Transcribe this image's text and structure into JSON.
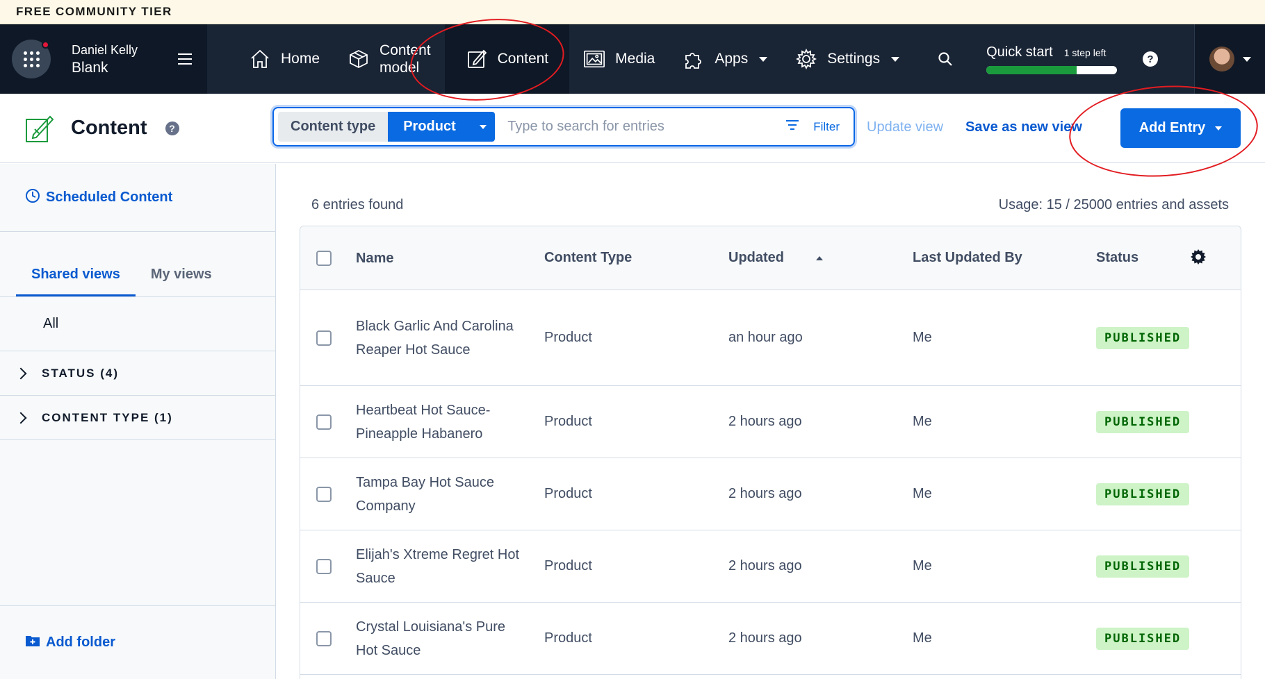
{
  "banner": {
    "text": "FREE COMMUNITY TIER"
  },
  "org": {
    "line1": "Daniel Kelly",
    "line2": "Blank"
  },
  "nav": {
    "home": "Home",
    "content_model_l1": "Content",
    "content_model_l2": "model",
    "content": "Content",
    "media": "Media",
    "apps": "Apps",
    "settings": "Settings"
  },
  "quickstart": {
    "title": "Quick start",
    "steps": "1 step left",
    "progress": 0.69
  },
  "header": {
    "title": "Content",
    "content_type_label": "Content type",
    "content_type_value": "Product",
    "search_placeholder": "Type to search for entries",
    "filter_label": "Filter",
    "update_view": "Update view",
    "save_view": "Save as new view",
    "add_entry": "Add Entry"
  },
  "sidebar": {
    "scheduled": "Scheduled Content",
    "tabs": [
      "Shared views",
      "My views"
    ],
    "all": "All",
    "folders": [
      "STATUS (4)",
      "CONTENT TYPE (1)"
    ],
    "add_folder": "Add folder"
  },
  "main": {
    "entries_found": "6 entries found",
    "usage": "Usage: 15 / 25000 entries and assets",
    "columns": [
      "Name",
      "Content Type",
      "Updated",
      "Last Updated By",
      "Status"
    ],
    "rows": [
      {
        "name": "Black Garlic And Carolina Reaper Hot Sauce",
        "type": "Product",
        "updated": "an hour ago",
        "by": "Me",
        "status": "PUBLISHED"
      },
      {
        "name": "Heartbeat Hot Sauce-Pineapple Habanero",
        "type": "Product",
        "updated": "2 hours ago",
        "by": "Me",
        "status": "PUBLISHED"
      },
      {
        "name": "Tampa Bay Hot Sauce Company",
        "type": "Product",
        "updated": "2 hours ago",
        "by": "Me",
        "status": "PUBLISHED"
      },
      {
        "name": "Elijah's Xtreme Regret Hot Sauce",
        "type": "Product",
        "updated": "2 hours ago",
        "by": "Me",
        "status": "PUBLISHED"
      },
      {
        "name": "Crystal Louisiana's Pure Hot Sauce",
        "type": "Product",
        "updated": "2 hours ago",
        "by": "Me",
        "status": "PUBLISHED"
      }
    ]
  },
  "colors": {
    "brand_blue": "#0a6ae1",
    "nav_bg": "#192435",
    "published_bg": "#cdf3c6",
    "annotation_red": "#e21c21"
  }
}
